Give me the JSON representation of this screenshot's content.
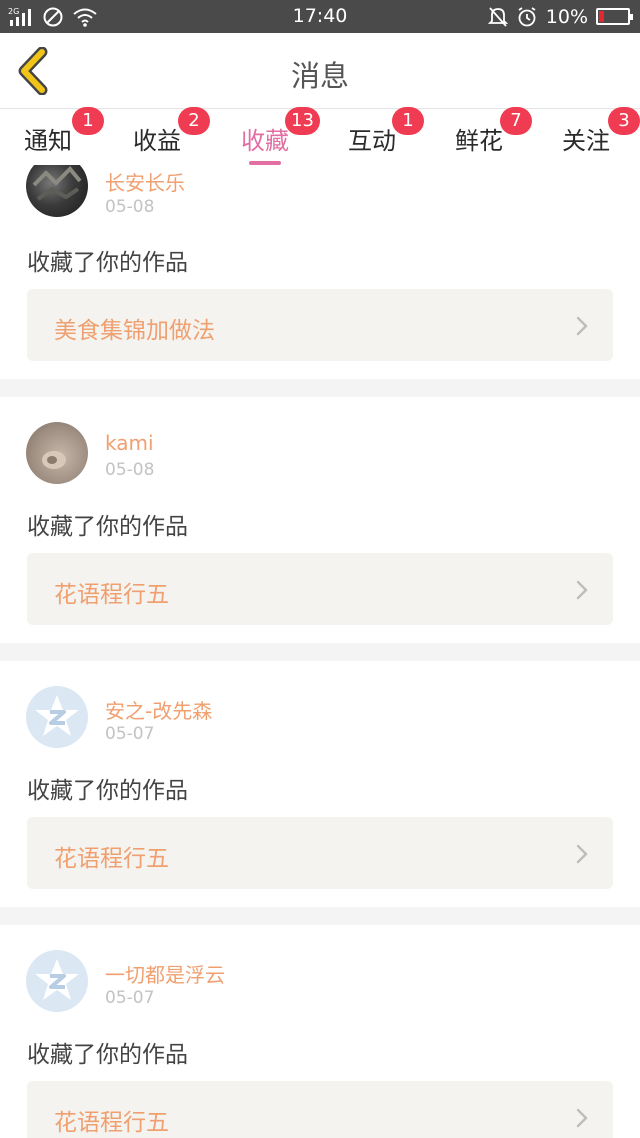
{
  "status_bar": {
    "network": "2G",
    "time": "17:40",
    "battery": "10%",
    "battery_level": 0.1,
    "icons": [
      "signal-icon",
      "no-sim-icon",
      "wifi-icon",
      "mute-icon",
      "alarm-icon",
      "battery-icon"
    ]
  },
  "header": {
    "title": "消息",
    "back_icon": "chevron-left-icon",
    "accent": "#f0c419"
  },
  "tabs": [
    {
      "label": "通知",
      "badge": "1"
    },
    {
      "label": "收益",
      "badge": "2"
    },
    {
      "label": "收藏",
      "badge": "13",
      "active": true
    },
    {
      "label": "互动",
      "badge": "1"
    },
    {
      "label": "鲜花",
      "badge": "7"
    },
    {
      "label": "关注",
      "badge": "3"
    }
  ],
  "items": [
    {
      "user": "长安长乐",
      "date": "05-08",
      "action": "收藏了你的作品",
      "work": "美食集锦加做法"
    },
    {
      "user": "kami",
      "date": "05-08",
      "action": "收藏了你的作品",
      "work": "花语程行五"
    },
    {
      "user": "安之-改先森",
      "date": "05-07",
      "action": "收藏了你的作品",
      "work": "花语程行五"
    },
    {
      "user": "一切都是浮云",
      "date": "05-07",
      "action": "收藏了你的作品",
      "work": "花语程行五"
    }
  ],
  "colors": {
    "active_tab": "#e36ea2",
    "badge": "#f03c52",
    "username": "#f0a070",
    "work_title": "#f0a070"
  }
}
